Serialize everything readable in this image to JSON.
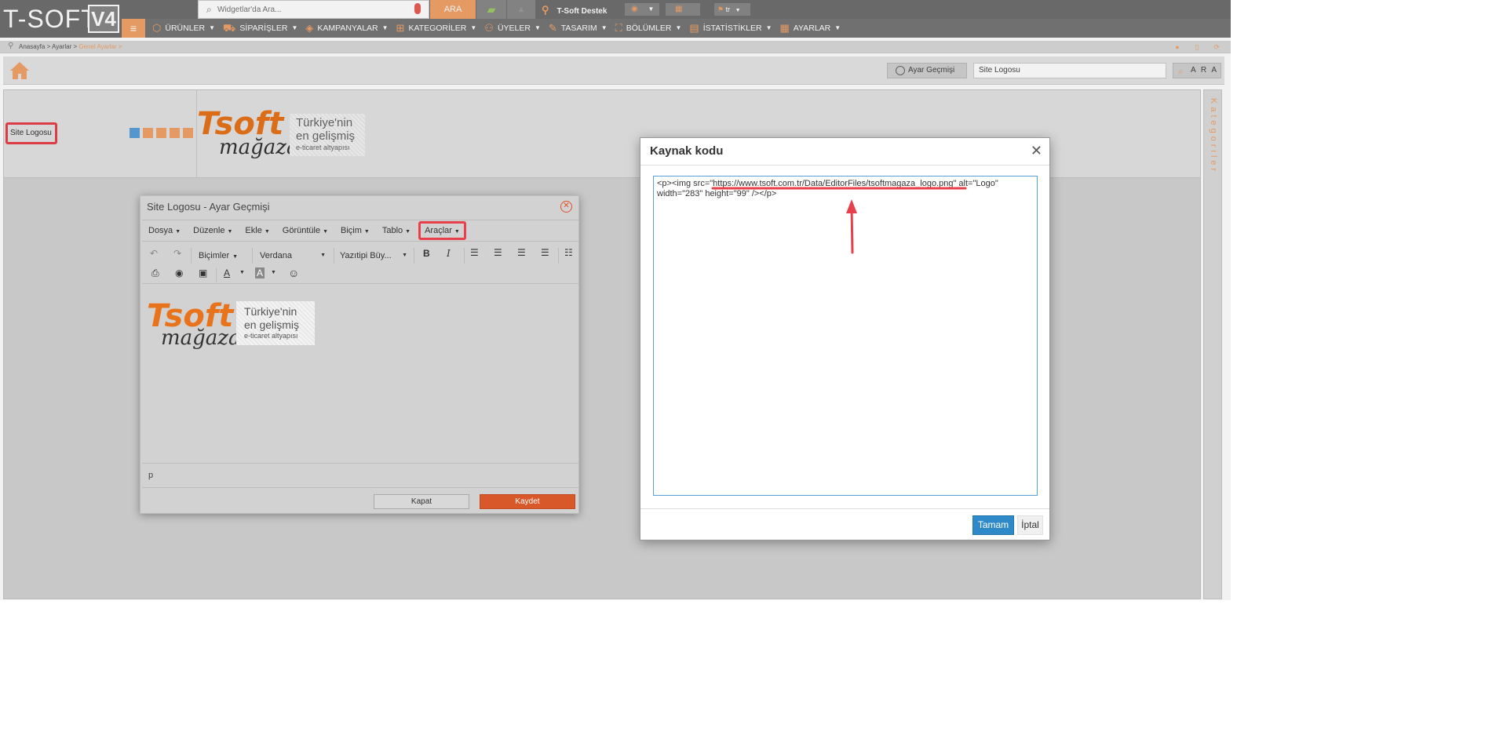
{
  "app": {
    "logo_text": "T-SOFT",
    "logo_version": "V4"
  },
  "topbar": {
    "search_placeholder": "Widgetlar'da Ara...",
    "search_button": "ARA",
    "support_label": "T-Soft Destek",
    "language": "tr"
  },
  "nav": {
    "items": [
      {
        "label": "ÜRÜNLER",
        "icon": "box-icon"
      },
      {
        "label": "SİPARİŞLER",
        "icon": "cart-icon"
      },
      {
        "label": "KAMPANYALAR",
        "icon": "tag-icon"
      },
      {
        "label": "KATEGORİLER",
        "icon": "sitemap-icon"
      },
      {
        "label": "ÜYELER",
        "icon": "users-icon"
      },
      {
        "label": "TASARIM",
        "icon": "brush-icon"
      },
      {
        "label": "BÖLÜMLER",
        "icon": "hierarchy-icon"
      },
      {
        "label": "İSTATİSTİKLER",
        "icon": "chart-icon"
      },
      {
        "label": "AYARLAR",
        "icon": "settings-icon"
      }
    ]
  },
  "breadcrumb": {
    "path": "Anasayfa > Ayarlar > ",
    "current": "Genel Ayarlar >"
  },
  "toolbar": {
    "history_button": "Ayar Geçmişi",
    "search_value": "Site Logosu",
    "search_button": "A R A"
  },
  "setting": {
    "label": "Site Logosu"
  },
  "logo_art": {
    "word": "Tsoft",
    "sub": "mağaza",
    "line1": "Türkiye'nin",
    "line2": "en gelişmiş",
    "line3": "e-ticaret altyapısı"
  },
  "right_panel": {
    "label": "Kategoriler"
  },
  "history_dialog": {
    "title": "Site Logosu - Ayar Geçmişi",
    "menus": [
      "Dosya",
      "Düzenle",
      "Ekle",
      "Görüntüle",
      "Biçim",
      "Tablo",
      "Araçlar"
    ],
    "formats_label": "Biçimler",
    "font_label": "Verdana",
    "font_size_label": "Yazıtipi Büy...",
    "status_path": "p",
    "close_button": "Kapat",
    "save_button": "Kaydet"
  },
  "source_modal": {
    "title": "Kaynak kodu",
    "code": "<p><img src=\"https://www.tsoft.com.tr/Data/EditorFiles/tsoftmagaza_logo.png\" alt=\"Logo\" width=\"283\" height=\"99\" /></p>",
    "ok_button": "Tamam",
    "cancel_button": "İptal"
  },
  "colors": {
    "accent": "#f2a36a",
    "brand_orange": "#e8731a",
    "highlight_red": "#e8404a",
    "primary_blue": "#2d89c8",
    "save_orange": "#d9582a"
  }
}
